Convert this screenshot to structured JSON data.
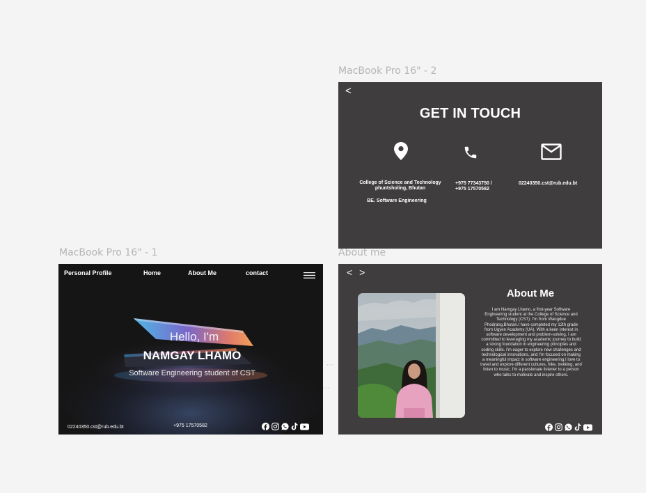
{
  "frames": {
    "contact_label": "MacBook Pro 16\" - 2",
    "hero_label": "MacBook Pro 16\" - 1",
    "about_label": "About me"
  },
  "contact": {
    "back": "<",
    "title": "GET IN TOUCH",
    "address_line1": "College of Science and Technology",
    "address_line2": "phuntsholing, Bhutan",
    "program": "BE. Software Engineering",
    "phone_line1": "+975  77343750 /",
    "phone_line2": "+975  17570582",
    "email": "02240350.cst@rub.edu.bt",
    "icons": [
      "location-pin-icon",
      "phone-icon",
      "mail-icon"
    ]
  },
  "hero": {
    "nav": {
      "brand": "Personal Profile",
      "home": "Home",
      "about": "About Me",
      "contact": "contact"
    },
    "greeting": "Hello, I'm",
    "name": "NAMGAY LHAMO",
    "subtitle": "Software Engineering student of CST",
    "footer_email": "02240350.cst@rub.edu.bt",
    "footer_phone": "+975 17570582"
  },
  "about": {
    "nav": "< >",
    "title": "About Me",
    "paragraph": "I am Namgay Lhamo, a first-year Software Engineering student at the College of Science and Technology (CST). I'm from Wangdue Phodrang,Bhutan.I have completed  my 12th grade from Ugyen Academy (UA). With a keen interest in software development and problem-solving, I am committed to leveraging my academic journey to build a strong foundation in engineering principles and coding skills. I'm eager to explore new challenges and technological innovations, and I'm focused on making a meaningful impact in software engineering.I love to travel and explore different cultures, hike, trekking, and listen to music. I'm a passionate listener to a person who talks to motivate and inspire others."
  },
  "socials": [
    "facebook-icon",
    "instagram-icon",
    "whatsapp-icon",
    "tiktok-icon",
    "youtube-icon"
  ],
  "colors": {
    "panel": "#3f3d3d",
    "canvas": "#f4f4f4",
    "label": "#b5b5b5"
  }
}
